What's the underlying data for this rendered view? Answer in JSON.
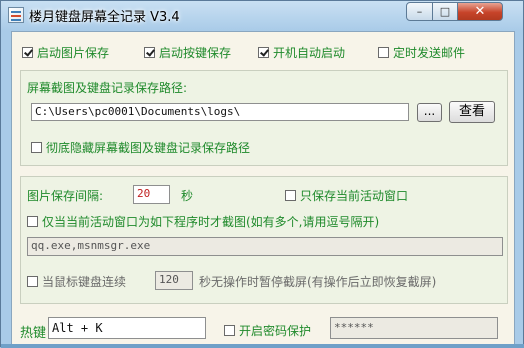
{
  "window": {
    "title": "楼月键盘屏幕全记录 V3.4",
    "controls": {
      "minimize": "–",
      "maximize": "□",
      "close": "✕"
    }
  },
  "options": {
    "start_image_save": {
      "label": "启动图片保存",
      "checked": true
    },
    "start_key_save": {
      "label": "启动按键保存",
      "checked": true
    },
    "auto_start": {
      "label": "开机自动启动",
      "checked": true
    },
    "timed_email": {
      "label": "定时发送邮件",
      "checked": false
    }
  },
  "save_path": {
    "label": "屏幕截图及键盘记录保存路径:",
    "value": "C:\\Users\\pc0001\\Documents\\logs\\",
    "browse_label": "...",
    "view_label": "查看",
    "hide_label": "彻底隐藏屏幕截图及键盘记录保存路径",
    "hide_checked": false
  },
  "capture": {
    "interval_label": "图片保存间隔:",
    "interval_value": "20",
    "interval_unit": "秒",
    "active_only_label": "只保存当前活动窗口",
    "active_only_checked": false,
    "program_filter_label": "仅当当前活动窗口为如下程序时才截图(如有多个,请用逗号隔开)",
    "program_filter_checked": false,
    "program_list": "qq.exe,msnmsgr.exe",
    "idle_prefix": "当鼠标键盘连续",
    "idle_value": "120",
    "idle_suffix": "秒无操作时暂停截屏(有操作后立即恢复截屏)",
    "idle_checked": false
  },
  "hotkey": {
    "label": "热键",
    "value": "Alt + K",
    "password_label": "开启密码保护",
    "password_checked": false,
    "password_value": "******"
  }
}
